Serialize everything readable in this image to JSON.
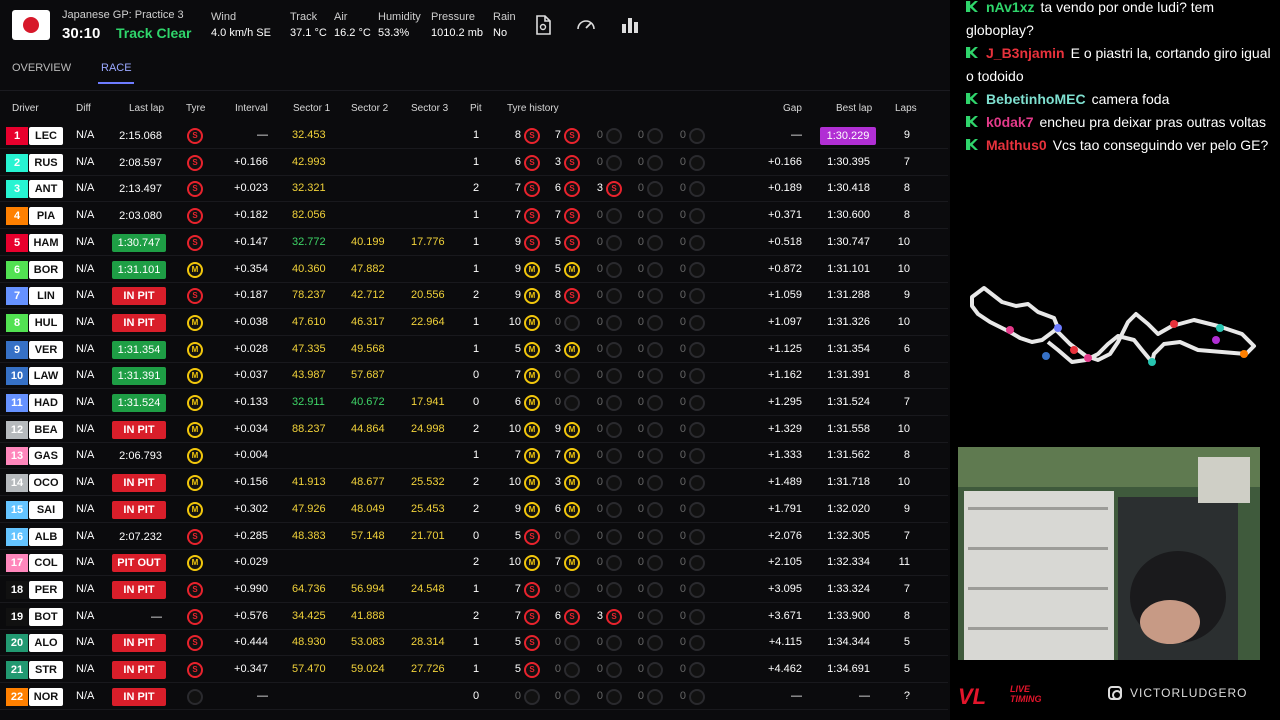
{
  "session": {
    "name": "Japanese GP: Practice 3",
    "clock": "30:10",
    "track_status": "Track Clear"
  },
  "weather": [
    {
      "label": "Wind",
      "value": "4.0 km/h SE"
    },
    {
      "label": "Track",
      "value": "37.1 °C"
    },
    {
      "label": "Air",
      "value": "16.2 °C"
    },
    {
      "label": "Humidity",
      "value": "53.3%"
    },
    {
      "label": "Pressure",
      "value": "1010.2 mb"
    },
    {
      "label": "Rain",
      "value": "No"
    }
  ],
  "toolbar": {
    "icons": [
      "document-icon",
      "gauge-icon",
      "bar-chart-icon"
    ]
  },
  "tabs": [
    {
      "label": "OVERVIEW"
    },
    {
      "label": "RACE",
      "active": true
    }
  ],
  "columns": [
    "Driver",
    "Diff",
    "Last lap",
    "Tyre",
    "Interval",
    "Sector 1",
    "Sector 2",
    "Sector 3",
    "Pit",
    "Tyre history",
    "Gap",
    "Best lap",
    "Laps"
  ],
  "drivers": [
    {
      "pos": "1",
      "code": "LEC",
      "team": "#e8002d",
      "diff": "N/A",
      "last": "2:15.068",
      "lastStyle": "plain",
      "tyre": "S",
      "interval": "—",
      "s1": "32.453",
      "s1c": "yel",
      "s2": "",
      "s2c": "",
      "s3": "",
      "s3c": "",
      "pit": "1",
      "hist": [
        [
          "8",
          "S"
        ],
        [
          "7",
          "S"
        ],
        [
          "0",
          "E"
        ],
        [
          "0",
          "E"
        ],
        [
          "0",
          "E"
        ]
      ],
      "gap": "—",
      "best": "1:30.229",
      "bestPurple": true,
      "laps": "9"
    },
    {
      "pos": "2",
      "code": "RUS",
      "team": "#27f4d2",
      "diff": "N/A",
      "last": "2:08.597",
      "lastStyle": "plain",
      "tyre": "S",
      "interval": "+0.166",
      "s1": "42.993",
      "s1c": "yel",
      "s2": "",
      "s2c": "",
      "s3": "",
      "s3c": "",
      "pit": "1",
      "hist": [
        [
          "6",
          "S"
        ],
        [
          "3",
          "S"
        ],
        [
          "0",
          "E"
        ],
        [
          "0",
          "E"
        ],
        [
          "0",
          "E"
        ]
      ],
      "gap": "+0.166",
      "best": "1:30.395",
      "bestPurple": false,
      "laps": "7"
    },
    {
      "pos": "3",
      "code": "ANT",
      "team": "#27f4d2",
      "diff": "N/A",
      "last": "2:13.497",
      "lastStyle": "plain",
      "tyre": "S",
      "interval": "+0.023",
      "s1": "32.321",
      "s1c": "yel",
      "s2": "",
      "s2c": "",
      "s3": "",
      "s3c": "",
      "pit": "2",
      "hist": [
        [
          "7",
          "S"
        ],
        [
          "6",
          "S"
        ],
        [
          "3",
          "S"
        ],
        [
          "0",
          "E"
        ],
        [
          "0",
          "E"
        ]
      ],
      "gap": "+0.189",
      "best": "1:30.418",
      "bestPurple": false,
      "laps": "8"
    },
    {
      "pos": "4",
      "code": "PIA",
      "team": "#ff8000",
      "diff": "N/A",
      "last": "2:03.080",
      "lastStyle": "plain",
      "tyre": "S",
      "interval": "+0.182",
      "s1": "82.056",
      "s1c": "yel",
      "s2": "",
      "s2c": "",
      "s3": "",
      "s3c": "",
      "pit": "1",
      "hist": [
        [
          "7",
          "S"
        ],
        [
          "7",
          "S"
        ],
        [
          "0",
          "E"
        ],
        [
          "0",
          "E"
        ],
        [
          "0",
          "E"
        ]
      ],
      "gap": "+0.371",
      "best": "1:30.600",
      "bestPurple": false,
      "laps": "8"
    },
    {
      "pos": "5",
      "code": "HAM",
      "team": "#e8002d",
      "diff": "N/A",
      "last": "1:30.747",
      "lastStyle": "green",
      "tyre": "S",
      "interval": "+0.147",
      "s1": "32.772",
      "s1c": "grn",
      "s2": "40.199",
      "s2c": "yel",
      "s3": "17.776",
      "s3c": "yel",
      "pit": "1",
      "hist": [
        [
          "9",
          "S"
        ],
        [
          "5",
          "S"
        ],
        [
          "0",
          "E"
        ],
        [
          "0",
          "E"
        ],
        [
          "0",
          "E"
        ]
      ],
      "gap": "+0.518",
      "best": "1:30.747",
      "bestPurple": false,
      "laps": "10"
    },
    {
      "pos": "6",
      "code": "BOR",
      "team": "#52e252",
      "diff": "N/A",
      "last": "1:31.101",
      "lastStyle": "green",
      "tyre": "M",
      "interval": "+0.354",
      "s1": "40.360",
      "s1c": "yel",
      "s2": "47.882",
      "s2c": "yel",
      "s3": "",
      "s3c": "",
      "pit": "1",
      "hist": [
        [
          "9",
          "M"
        ],
        [
          "5",
          "M"
        ],
        [
          "0",
          "E"
        ],
        [
          "0",
          "E"
        ],
        [
          "0",
          "E"
        ]
      ],
      "gap": "+0.872",
      "best": "1:31.101",
      "bestPurple": false,
      "laps": "10"
    },
    {
      "pos": "7",
      "code": "LIN",
      "team": "#6692ff",
      "diff": "N/A",
      "last": "IN PIT",
      "lastStyle": "pit",
      "tyre": "S",
      "interval": "+0.187",
      "s1": "78.237",
      "s1c": "yel",
      "s2": "42.712",
      "s2c": "yel",
      "s3": "20.556",
      "s3c": "yel",
      "pit": "2",
      "hist": [
        [
          "9",
          "M"
        ],
        [
          "8",
          "S"
        ],
        [
          "0",
          "E"
        ],
        [
          "0",
          "E"
        ],
        [
          "0",
          "E"
        ]
      ],
      "gap": "+1.059",
      "best": "1:31.288",
      "bestPurple": false,
      "laps": "9"
    },
    {
      "pos": "8",
      "code": "HUL",
      "team": "#52e252",
      "diff": "N/A",
      "last": "IN PIT",
      "lastStyle": "pit",
      "tyre": "M",
      "interval": "+0.038",
      "s1": "47.610",
      "s1c": "yel",
      "s2": "46.317",
      "s2c": "yel",
      "s3": "22.964",
      "s3c": "yel",
      "pit": "1",
      "hist": [
        [
          "10",
          "M"
        ],
        [
          "0",
          "E"
        ],
        [
          "0",
          "E"
        ],
        [
          "0",
          "E"
        ],
        [
          "0",
          "E"
        ]
      ],
      "gap": "+1.097",
      "best": "1:31.326",
      "bestPurple": false,
      "laps": "10"
    },
    {
      "pos": "9",
      "code": "VER",
      "team": "#3671c6",
      "diff": "N/A",
      "last": "1:31.354",
      "lastStyle": "green",
      "tyre": "M",
      "interval": "+0.028",
      "s1": "47.335",
      "s1c": "yel",
      "s2": "49.568",
      "s2c": "yel",
      "s3": "",
      "s3c": "",
      "pit": "1",
      "hist": [
        [
          "5",
          "M"
        ],
        [
          "3",
          "M"
        ],
        [
          "0",
          "E"
        ],
        [
          "0",
          "E"
        ],
        [
          "0",
          "E"
        ]
      ],
      "gap": "+1.125",
      "best": "1:31.354",
      "bestPurple": false,
      "laps": "6"
    },
    {
      "pos": "10",
      "code": "LAW",
      "team": "#3671c6",
      "diff": "N/A",
      "last": "1:31.391",
      "lastStyle": "green",
      "tyre": "M",
      "interval": "+0.037",
      "s1": "43.987",
      "s1c": "yel",
      "s2": "57.687",
      "s2c": "yel",
      "s3": "",
      "s3c": "",
      "pit": "0",
      "hist": [
        [
          "7",
          "M"
        ],
        [
          "0",
          "E"
        ],
        [
          "0",
          "E"
        ],
        [
          "0",
          "E"
        ],
        [
          "0",
          "E"
        ]
      ],
      "gap": "+1.162",
      "best": "1:31.391",
      "bestPurple": false,
      "laps": "8"
    },
    {
      "pos": "11",
      "code": "HAD",
      "team": "#6692ff",
      "diff": "N/A",
      "last": "1:31.524",
      "lastStyle": "green",
      "tyre": "M",
      "interval": "+0.133",
      "s1": "32.911",
      "s1c": "grn",
      "s2": "40.672",
      "s2c": "grn",
      "s3": "17.941",
      "s3c": "yel",
      "pit": "0",
      "hist": [
        [
          "6",
          "M"
        ],
        [
          "0",
          "E"
        ],
        [
          "0",
          "E"
        ],
        [
          "0",
          "E"
        ],
        [
          "0",
          "E"
        ]
      ],
      "gap": "+1.295",
      "best": "1:31.524",
      "bestPurple": false,
      "laps": "7"
    },
    {
      "pos": "12",
      "code": "BEA",
      "team": "#b6babd",
      "diff": "N/A",
      "last": "IN PIT",
      "lastStyle": "pit",
      "tyre": "M",
      "interval": "+0.034",
      "s1": "88.237",
      "s1c": "yel",
      "s2": "44.864",
      "s2c": "yel",
      "s3": "24.998",
      "s3c": "yel",
      "pit": "2",
      "hist": [
        [
          "10",
          "M"
        ],
        [
          "9",
          "M"
        ],
        [
          "0",
          "E"
        ],
        [
          "0",
          "E"
        ],
        [
          "0",
          "E"
        ]
      ],
      "gap": "+1.329",
      "best": "1:31.558",
      "bestPurple": false,
      "laps": "10"
    },
    {
      "pos": "13",
      "code": "GAS",
      "team": "#ff87bc",
      "diff": "N/A",
      "last": "2:06.793",
      "lastStyle": "plain",
      "tyre": "M",
      "interval": "+0.004",
      "s1": "",
      "s1c": "",
      "s2": "",
      "s2c": "",
      "s3": "",
      "s3c": "",
      "pit": "1",
      "hist": [
        [
          "7",
          "M"
        ],
        [
          "7",
          "M"
        ],
        [
          "0",
          "E"
        ],
        [
          "0",
          "E"
        ],
        [
          "0",
          "E"
        ]
      ],
      "gap": "+1.333",
      "best": "1:31.562",
      "bestPurple": false,
      "laps": "8"
    },
    {
      "pos": "14",
      "code": "OCO",
      "team": "#b6babd",
      "diff": "N/A",
      "last": "IN PIT",
      "lastStyle": "pit",
      "tyre": "M",
      "interval": "+0.156",
      "s1": "41.913",
      "s1c": "yel",
      "s2": "48.677",
      "s2c": "yel",
      "s3": "25.532",
      "s3c": "yel",
      "pit": "2",
      "hist": [
        [
          "10",
          "M"
        ],
        [
          "3",
          "M"
        ],
        [
          "0",
          "E"
        ],
        [
          "0",
          "E"
        ],
        [
          "0",
          "E"
        ]
      ],
      "gap": "+1.489",
      "best": "1:31.718",
      "bestPurple": false,
      "laps": "10"
    },
    {
      "pos": "15",
      "code": "SAI",
      "team": "#64c4ff",
      "diff": "N/A",
      "last": "IN PIT",
      "lastStyle": "pit",
      "tyre": "M",
      "interval": "+0.302",
      "s1": "47.926",
      "s1c": "yel",
      "s2": "48.049",
      "s2c": "yel",
      "s3": "25.453",
      "s3c": "yel",
      "pit": "2",
      "hist": [
        [
          "9",
          "M"
        ],
        [
          "6",
          "M"
        ],
        [
          "0",
          "E"
        ],
        [
          "0",
          "E"
        ],
        [
          "0",
          "E"
        ]
      ],
      "gap": "+1.791",
      "best": "1:32.020",
      "bestPurple": false,
      "laps": "9"
    },
    {
      "pos": "16",
      "code": "ALB",
      "team": "#64c4ff",
      "diff": "N/A",
      "last": "2:07.232",
      "lastStyle": "plain",
      "tyre": "S",
      "interval": "+0.285",
      "s1": "48.383",
      "s1c": "yel",
      "s2": "57.148",
      "s2c": "yel",
      "s3": "21.701",
      "s3c": "yel",
      "pit": "0",
      "hist": [
        [
          "5",
          "S"
        ],
        [
          "0",
          "E"
        ],
        [
          "0",
          "E"
        ],
        [
          "0",
          "E"
        ],
        [
          "0",
          "E"
        ]
      ],
      "gap": "+2.076",
      "best": "1:32.305",
      "bestPurple": false,
      "laps": "7"
    },
    {
      "pos": "17",
      "code": "COL",
      "team": "#ff87bc",
      "diff": "N/A",
      "last": "PIT OUT",
      "lastStyle": "pit",
      "tyre": "M",
      "interval": "+0.029",
      "s1": "",
      "s1c": "",
      "s2": "",
      "s2c": "",
      "s3": "",
      "s3c": "",
      "pit": "2",
      "hist": [
        [
          "10",
          "M"
        ],
        [
          "7",
          "M"
        ],
        [
          "0",
          "E"
        ],
        [
          "0",
          "E"
        ],
        [
          "0",
          "E"
        ]
      ],
      "gap": "+2.105",
      "best": "1:32.334",
      "bestPurple": false,
      "laps": "11"
    },
    {
      "pos": "18",
      "code": "PER",
      "team": "#000000",
      "diff": "N/A",
      "last": "IN PIT",
      "lastStyle": "pit",
      "tyre": "S",
      "interval": "+0.990",
      "s1": "64.736",
      "s1c": "yel",
      "s2": "56.994",
      "s2c": "yel",
      "s3": "24.548",
      "s3c": "yel",
      "pit": "1",
      "hist": [
        [
          "7",
          "S"
        ],
        [
          "0",
          "E"
        ],
        [
          "0",
          "E"
        ],
        [
          "0",
          "E"
        ],
        [
          "0",
          "E"
        ]
      ],
      "gap": "+3.095",
      "best": "1:33.324",
      "bestPurple": false,
      "laps": "7"
    },
    {
      "pos": "19",
      "code": "BOT",
      "team": "#000000",
      "diff": "N/A",
      "last": "—",
      "lastStyle": "plain",
      "tyre": "S",
      "interval": "+0.576",
      "s1": "34.425",
      "s1c": "yel",
      "s2": "41.888",
      "s2c": "yel",
      "s3": "",
      "s3c": "",
      "pit": "2",
      "hist": [
        [
          "7",
          "S"
        ],
        [
          "6",
          "S"
        ],
        [
          "3",
          "S"
        ],
        [
          "0",
          "E"
        ],
        [
          "0",
          "E"
        ]
      ],
      "gap": "+3.671",
      "best": "1:33.900",
      "bestPurple": false,
      "laps": "8"
    },
    {
      "pos": "20",
      "code": "ALO",
      "team": "#229971",
      "diff": "N/A",
      "last": "IN PIT",
      "lastStyle": "pit",
      "tyre": "S",
      "interval": "+0.444",
      "s1": "48.930",
      "s1c": "yel",
      "s2": "53.083",
      "s2c": "yel",
      "s3": "28.314",
      "s3c": "yel",
      "pit": "1",
      "hist": [
        [
          "5",
          "S"
        ],
        [
          "0",
          "E"
        ],
        [
          "0",
          "E"
        ],
        [
          "0",
          "E"
        ],
        [
          "0",
          "E"
        ]
      ],
      "gap": "+4.115",
      "best": "1:34.344",
      "bestPurple": false,
      "laps": "5"
    },
    {
      "pos": "21",
      "code": "STR",
      "team": "#229971",
      "diff": "N/A",
      "last": "IN PIT",
      "lastStyle": "pit",
      "tyre": "S",
      "interval": "+0.347",
      "s1": "57.470",
      "s1c": "yel",
      "s2": "59.024",
      "s2c": "yel",
      "s3": "27.726",
      "s3c": "yel",
      "pit": "1",
      "hist": [
        [
          "5",
          "S"
        ],
        [
          "0",
          "E"
        ],
        [
          "0",
          "E"
        ],
        [
          "0",
          "E"
        ],
        [
          "0",
          "E"
        ]
      ],
      "gap": "+4.462",
      "best": "1:34.691",
      "bestPurple": false,
      "laps": "5"
    },
    {
      "pos": "22",
      "code": "NOR",
      "team": "#ff8000",
      "diff": "N/A",
      "last": "IN PIT",
      "lastStyle": "pit",
      "tyre": "E",
      "interval": "—",
      "s1": "",
      "s1c": "",
      "s2": "",
      "s2c": "",
      "s3": "",
      "s3c": "",
      "pit": "0",
      "hist": [
        [
          "0",
          "E"
        ],
        [
          "0",
          "E"
        ],
        [
          "0",
          "E"
        ],
        [
          "0",
          "E"
        ],
        [
          "0",
          "E"
        ]
      ],
      "gap": "—",
      "best": "—",
      "bestPurple": false,
      "laps": "?"
    }
  ],
  "chat": [
    {
      "user": "nAv1xz",
      "color": "#2fd56b",
      "text": "ta vendo por onde ludi? tem globoplay?"
    },
    {
      "user": "J_B3njamin",
      "color": "#e8323c",
      "text": "E o piastri la, cortando giro igual o todoido"
    },
    {
      "user": "BebetinhoMEC",
      "color": "#7fe0d0",
      "text": "camera foda"
    },
    {
      "user": "k0dak7",
      "color": "#e43a8a",
      "text": "encheu pra deixar pras outras voltas"
    },
    {
      "user": "Malthus0",
      "color": "#e8323c",
      "text": "Vcs tao conseguindo ver pelo GE?"
    }
  ],
  "footer": {
    "brand": "VL",
    "brand_sub_1": "LIVE",
    "brand_sub_2": "TIMING",
    "handle": "VICTORLUDGERO"
  },
  "colors": {
    "accent": "#6e7cff",
    "purple": "#b12fd4",
    "pit": "#d91e2a",
    "green": "#1e9e45",
    "soft": "#e8232d",
    "medium": "#f2c70c"
  }
}
